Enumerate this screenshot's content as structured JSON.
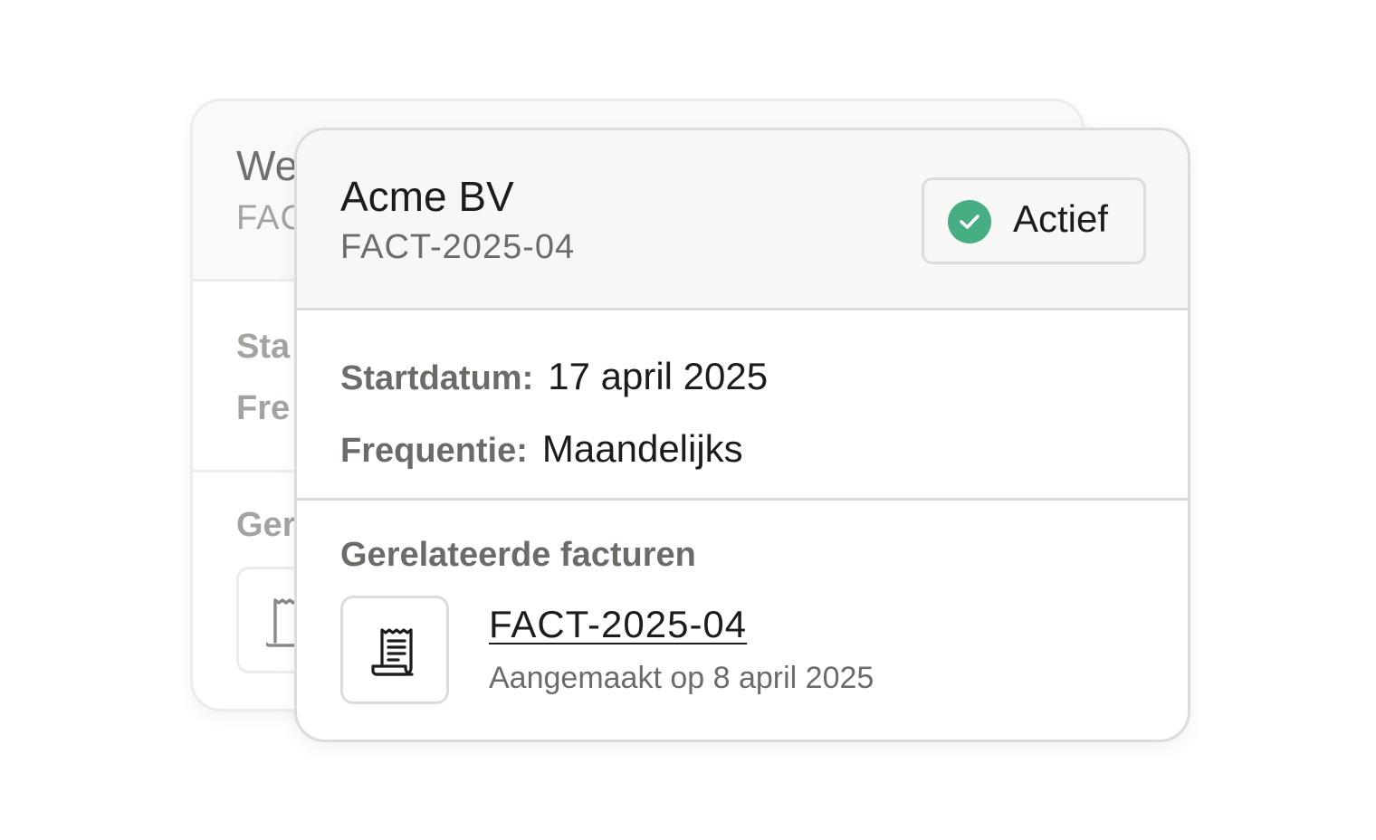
{
  "back_card": {
    "title": "We",
    "invoice_number": "FAC",
    "start_label": "Sta",
    "frequency_label": "Fre",
    "related_heading": "Ger"
  },
  "front_card": {
    "customer_name": "Acme BV",
    "invoice_number": "FACT-2025-04",
    "status": {
      "label": "Actief",
      "icon": "check-circle-icon",
      "color": "#46ae82"
    },
    "details": {
      "start_label": "Startdatum:",
      "start_value": "17 april 2025",
      "frequency_label": "Frequentie:",
      "frequency_value": "Maandelijks"
    },
    "related": {
      "heading": "Gerelateerde facturen",
      "items": [
        {
          "icon": "receipt-icon",
          "invoice_number": "FACT-2025-04",
          "created": "Aangemaakt op 8 april 2025"
        }
      ]
    }
  }
}
